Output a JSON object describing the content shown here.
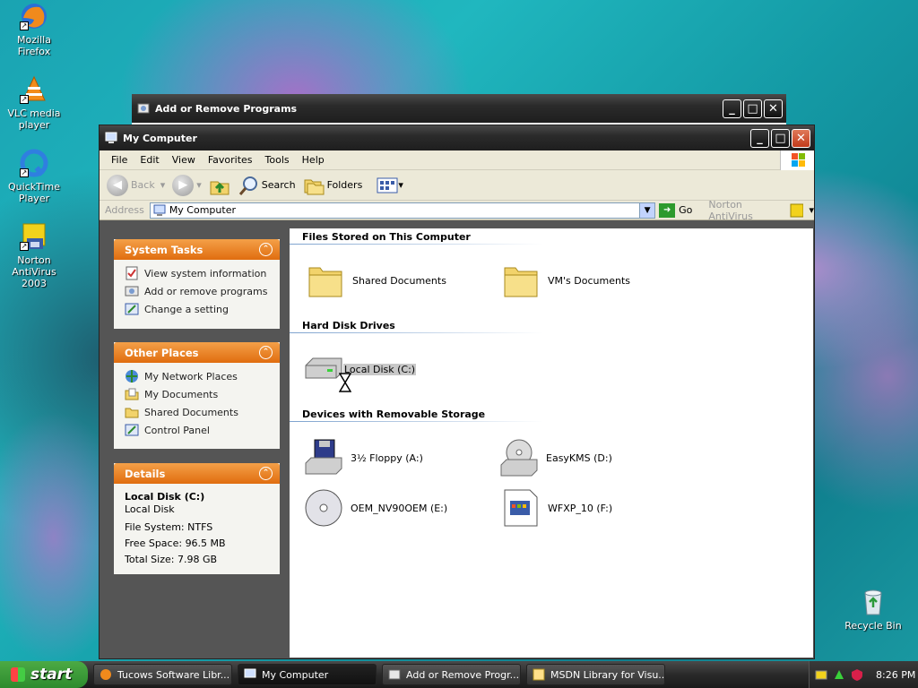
{
  "desktop": {
    "icons": [
      {
        "label": "Mozilla Firefox"
      },
      {
        "label": "VLC media player"
      },
      {
        "label": "QuickTime Player"
      },
      {
        "label": "Norton AntiVirus 2003"
      },
      {
        "label": "Recycle Bin"
      }
    ]
  },
  "back_window": {
    "title": "Add or Remove Programs"
  },
  "window": {
    "title": "My Computer",
    "menu": [
      "File",
      "Edit",
      "View",
      "Favorites",
      "Tools",
      "Help"
    ],
    "toolbar": {
      "back": "Back",
      "search": "Search",
      "folders": "Folders"
    },
    "address": {
      "label": "Address",
      "value": "My Computer",
      "go": "Go",
      "norton": "Norton AntiVirus"
    },
    "system_tasks": {
      "title": "System Tasks",
      "items": [
        "View system information",
        "Add or remove programs",
        "Change a setting"
      ]
    },
    "other_places": {
      "title": "Other Places",
      "items": [
        "My Network Places",
        "My Documents",
        "Shared Documents",
        "Control Panel"
      ]
    },
    "details": {
      "title": "Details",
      "name": "Local Disk (C:)",
      "type": "Local Disk",
      "fs": "File System: NTFS",
      "free": "Free Space: 96.5 MB",
      "total": "Total Size: 7.98 GB"
    },
    "sections": {
      "files_stored": "Files Stored on This Computer",
      "hard_disks": "Hard Disk Drives",
      "removable": "Devices with Removable Storage"
    },
    "files": [
      "Shared Documents",
      "VM's Documents"
    ],
    "hard_disks": [
      "Local Disk (C:)"
    ],
    "removable": [
      "3½ Floppy (A:)",
      "EasyKMS (D:)",
      "OEM_NV90OEM (E:)",
      "WFXP_10 (F:)"
    ]
  },
  "taskbar": {
    "start": "start",
    "tasks": [
      "Tucows Software Libr...",
      "My Computer",
      "Add or Remove Progr...",
      "MSDN Library for Visu..."
    ],
    "clock": "8:26 PM"
  }
}
